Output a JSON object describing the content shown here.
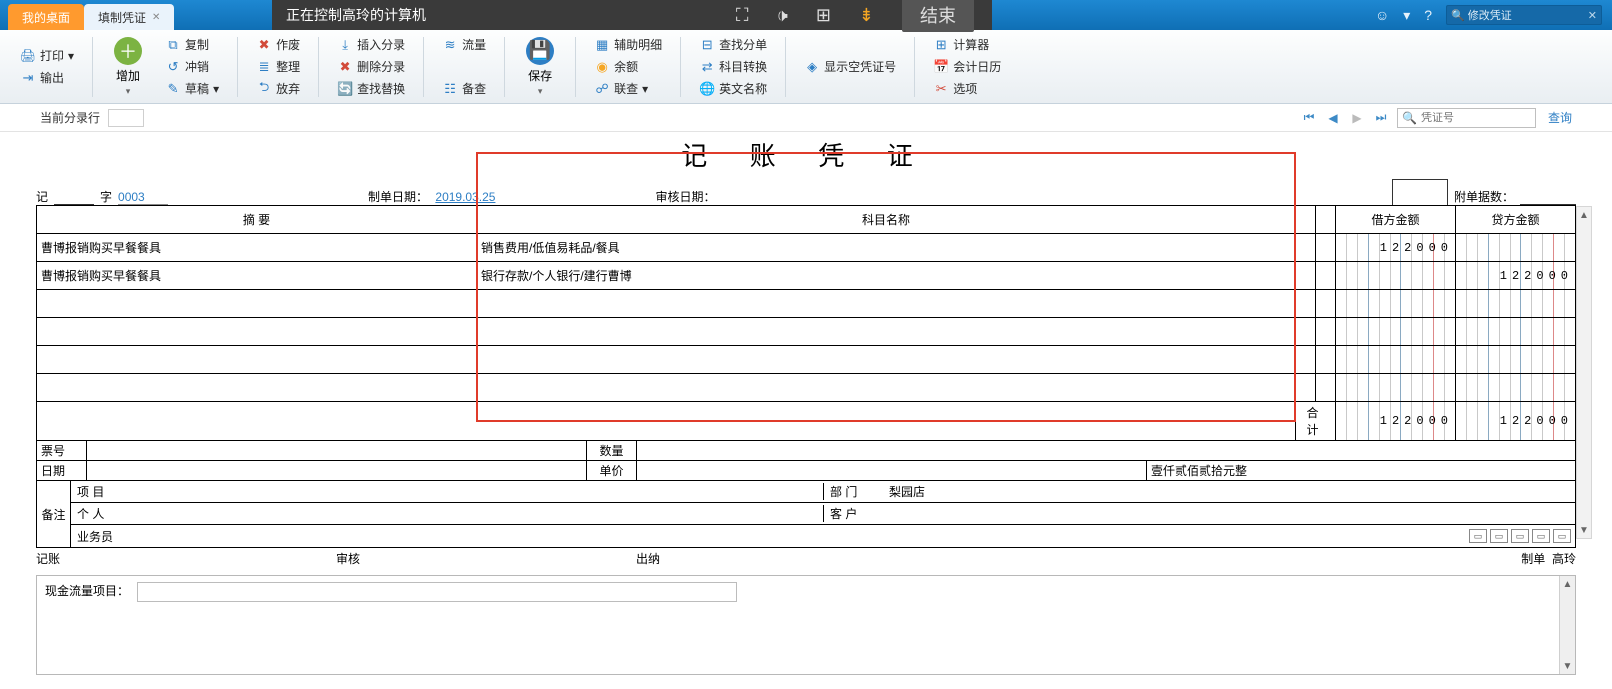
{
  "remote": {
    "message": "正在控制高玲的计算机",
    "end": "结束"
  },
  "tabs": {
    "inactive": "我的桌面",
    "active": "填制凭证"
  },
  "topSearch": {
    "placeholder": "修改凭证"
  },
  "ribbon": {
    "print": "打印",
    "output": "输出",
    "add": "增加",
    "copy": "复制",
    "offset": "冲销",
    "draft": "草稿",
    "void": "作废",
    "tidy": "整理",
    "abandon": "放弃",
    "insertEntry": "插入分录",
    "deleteEntry": "删除分录",
    "findReplace": "查找替换",
    "flow": "流量",
    "backup": "备查",
    "save": "保存",
    "auxDetail": "辅助明细",
    "balance": "余额",
    "relQuery": "联查",
    "findSplit": "查找分单",
    "subjConvert": "科目转换",
    "engName": "英文名称",
    "showEmpty": "显示空凭证号",
    "calculator": "计算器",
    "acctCalendar": "会计日历",
    "options": "选项"
  },
  "subbar": {
    "currentLine": "当前分录行",
    "voucherNoPlaceholder": "凭证号",
    "query": "查询"
  },
  "voucher": {
    "title": "记 账 凭 证",
    "prefix": "记",
    "suffix": "字",
    "number": "0003",
    "makeDateLabel": "制单日期：",
    "makeDate": "2019.03.25",
    "auditDateLabel": "审核日期：",
    "attachLabel": "附单据数：",
    "headers": {
      "summary": "摘 要",
      "subject": "科目名称",
      "debit": "借方金额",
      "credit": "贷方金额"
    },
    "rows": [
      {
        "summary": "曹博报销购买早餐餐具",
        "subject": "销售费用/低值易耗品/餐具",
        "debit": "122000",
        "credit": ""
      },
      {
        "summary": "曹博报销购买早餐餐具",
        "subject": "银行存款/个人银行/建行曹博",
        "debit": "",
        "credit": "122000"
      }
    ],
    "totalLabel": "合 计",
    "totalDebit": "122000",
    "totalCredit": "122000",
    "billNo": "票号",
    "date": "日期",
    "qty": "数量",
    "price": "单价",
    "capsAmount": "壹仟贰佰贰拾元整",
    "memo": "备注",
    "project": "项 目",
    "dept": "部 门",
    "deptVal": "梨园店",
    "person": "个 人",
    "customer": "客 户",
    "operator": "业务员",
    "signPost": "记账",
    "signAudit": "审核",
    "signCashier": "出纳",
    "signMaker": "制单",
    "signMakerVal": "高玲"
  },
  "cashflow": {
    "label": "现金流量项目："
  }
}
